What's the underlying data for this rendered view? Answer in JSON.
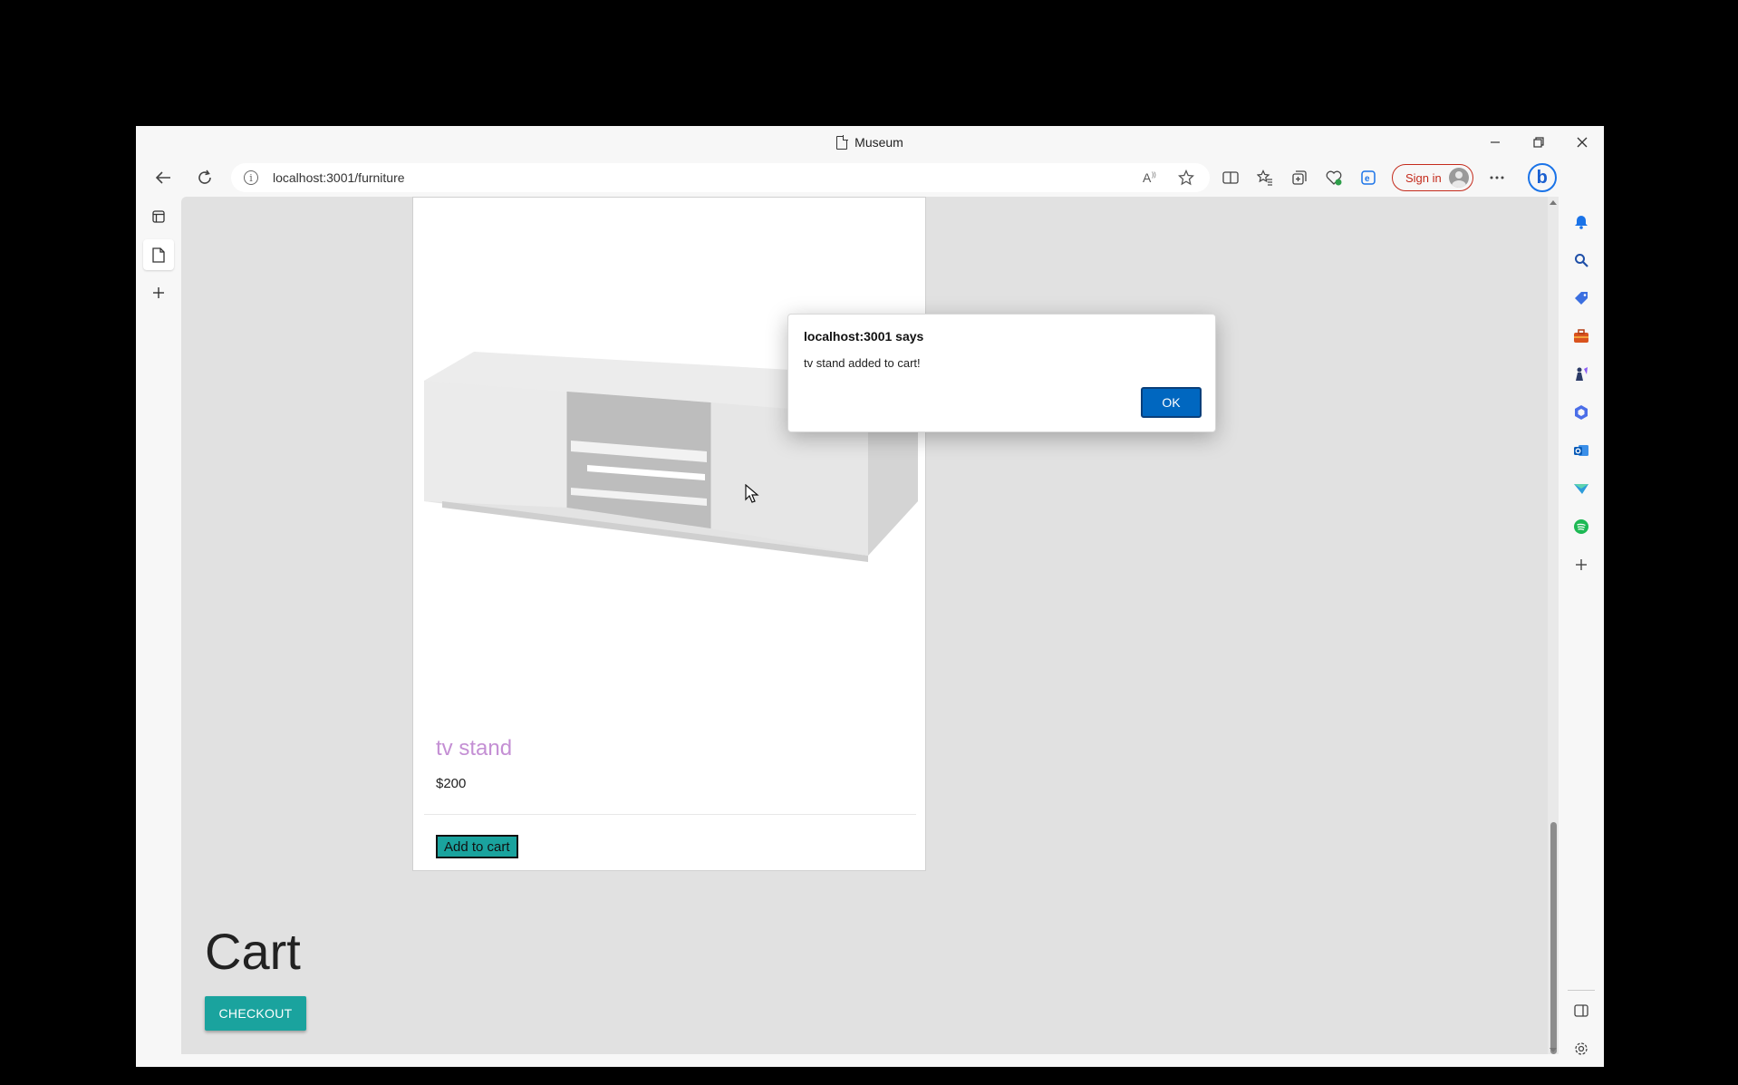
{
  "window": {
    "title": "Museum"
  },
  "address_bar": {
    "url": "localhost:3001/furniture"
  },
  "toolbar": {
    "sign_in_label": "Sign in"
  },
  "product": {
    "name": "tv stand",
    "price": "$200",
    "add_to_cart_label": "Add to cart"
  },
  "cart": {
    "heading": "Cart",
    "checkout_label": "CHECKOUT"
  },
  "dialog": {
    "title": "localhost:3001 says",
    "message": "tv stand added to cart!",
    "ok_label": "OK"
  },
  "colors": {
    "accent_teal": "#1aa39e",
    "product_title": "#c48fd4",
    "dialog_button": "#0067c0",
    "signin_border": "#c42b1c"
  }
}
